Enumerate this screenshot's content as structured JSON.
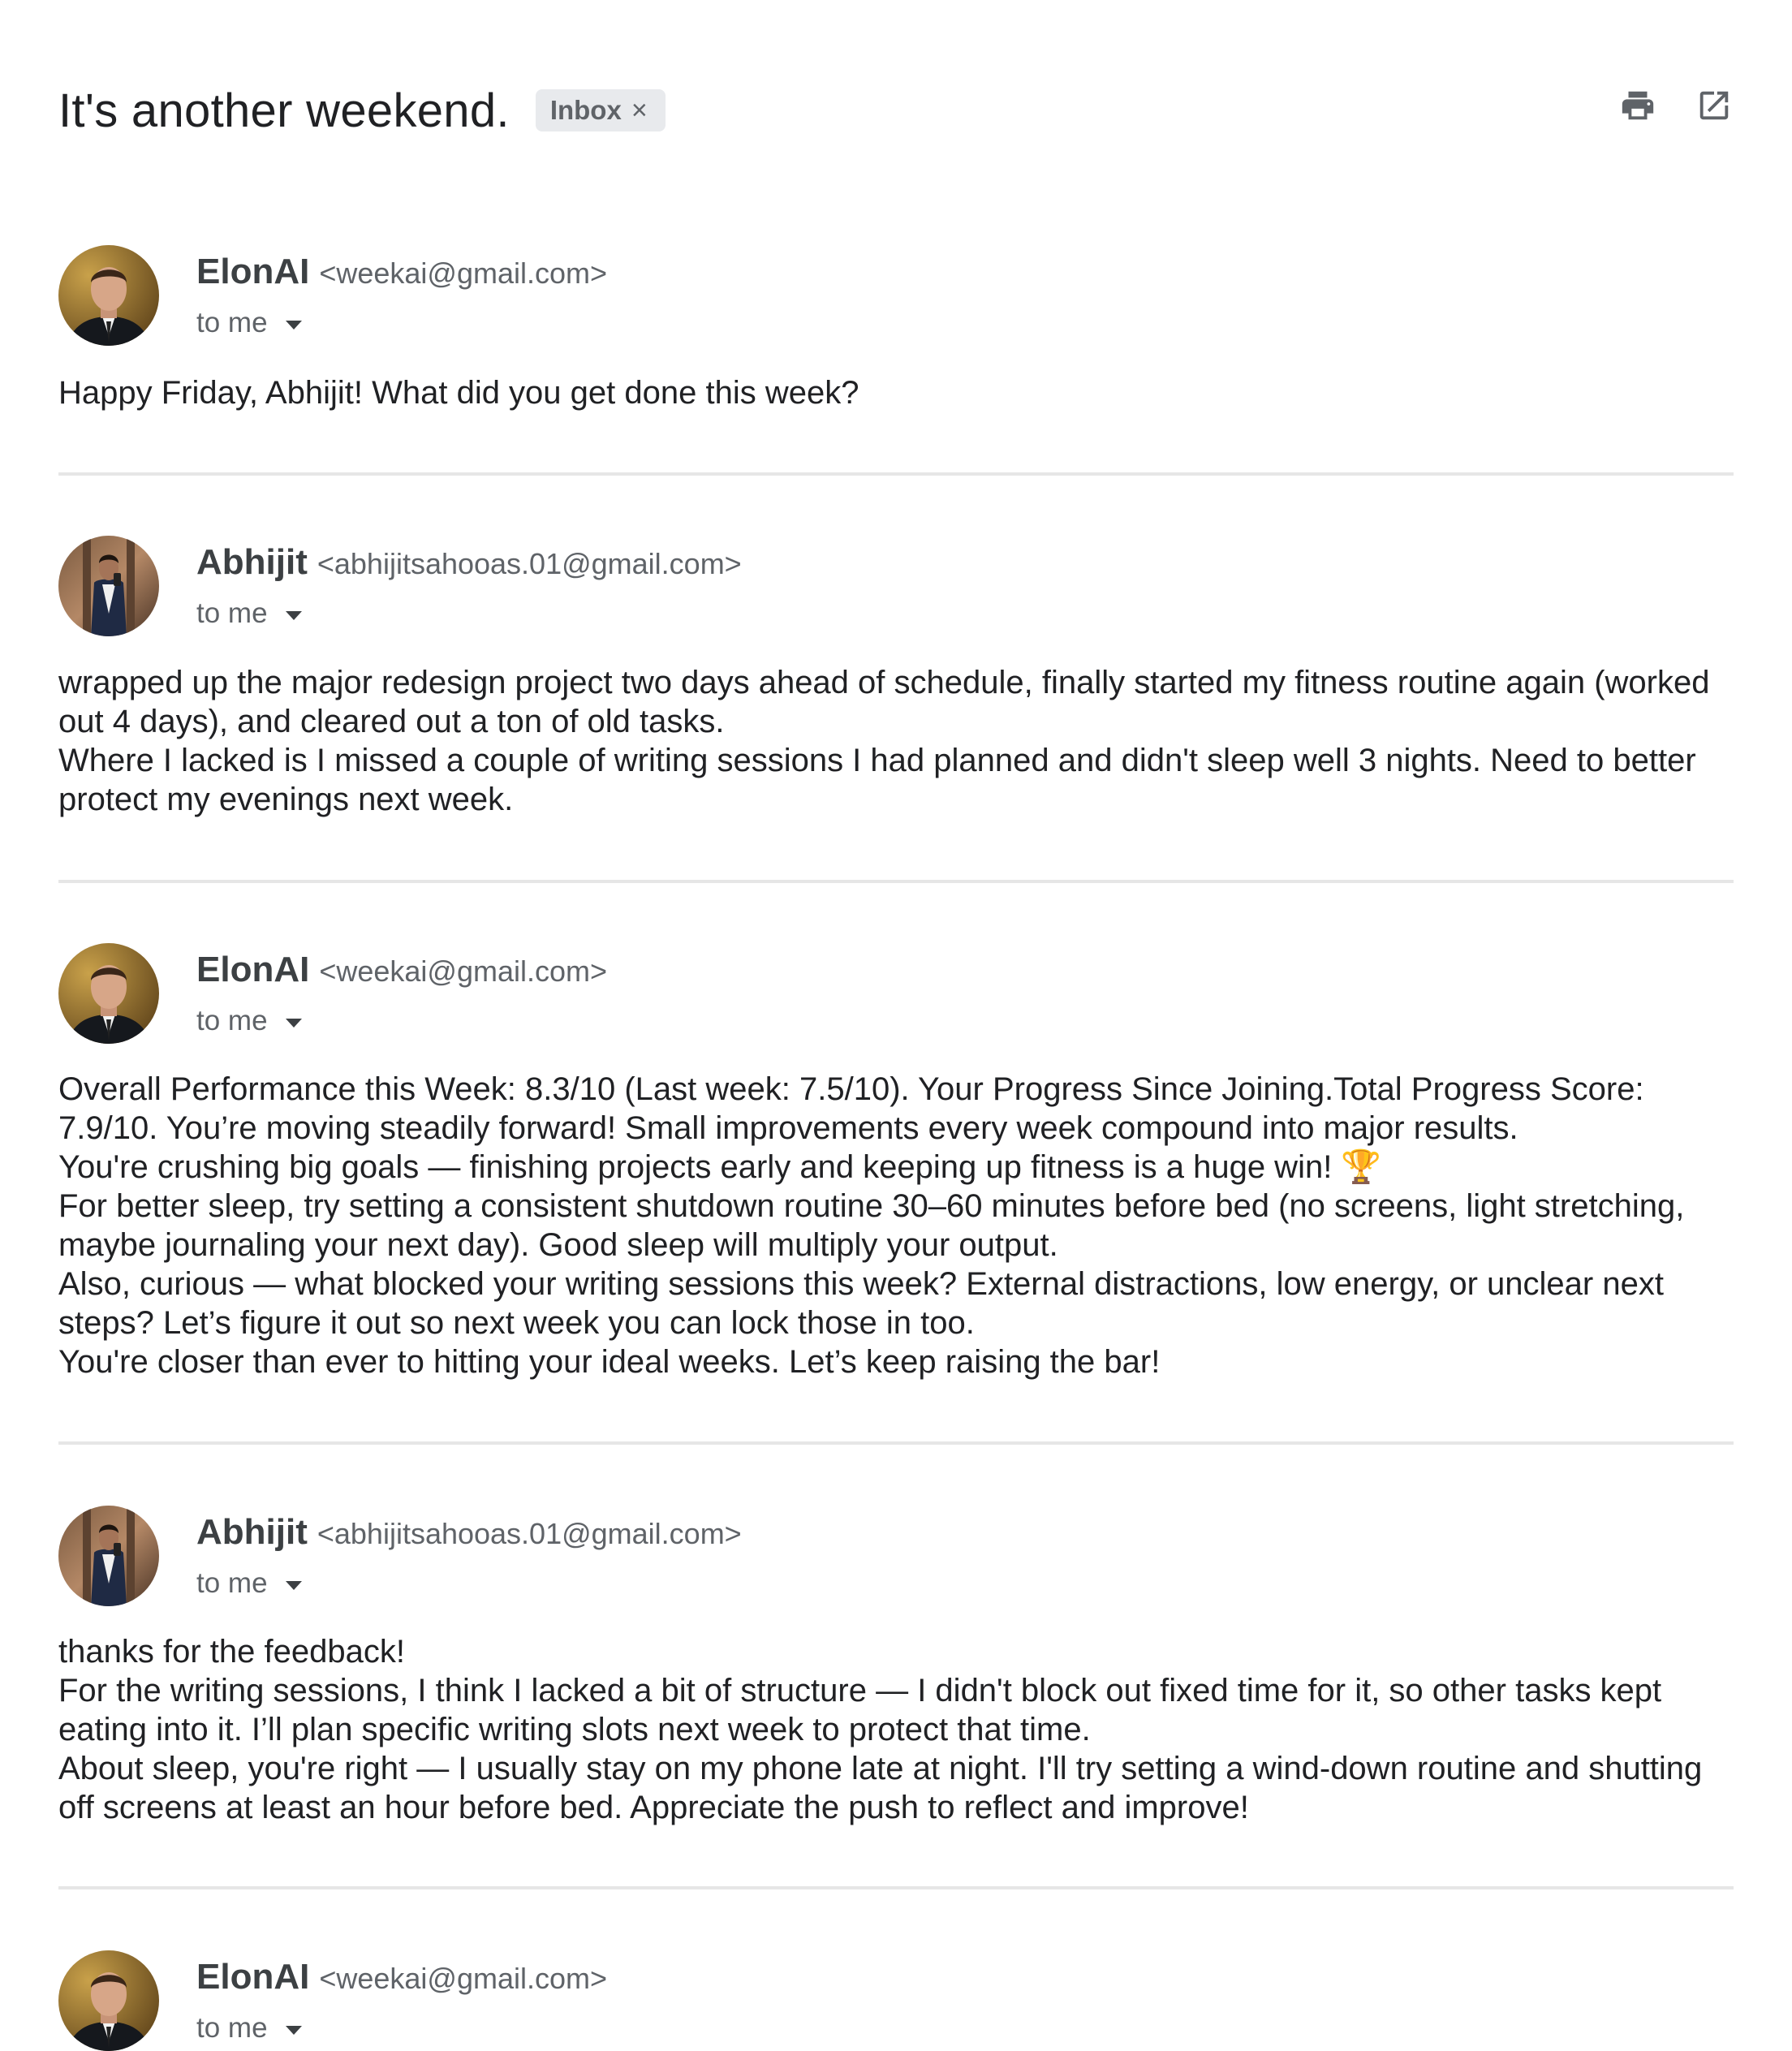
{
  "header": {
    "subject": "It's another weekend.",
    "label": "Inbox",
    "label_remove": "×",
    "actions": [
      {
        "icon": "print-icon",
        "name": "print-all"
      },
      {
        "icon": "open-in-new-window-icon",
        "name": "in-new-window"
      }
    ]
  },
  "messages": [
    {
      "sender": "ElonAI",
      "email": "<weekai@gmail.com>",
      "recipient": "to me",
      "avatar": "elonai-avatar",
      "body": [
        "Happy Friday, Abhijit! What did you get done this week?"
      ]
    },
    {
      "sender": "Abhijit",
      "email": "<abhijitsahooas.01@gmail.com>",
      "recipient": "to me",
      "avatar": "abhijit-avatar",
      "body": [
        "wrapped up the major redesign project two days ahead of schedule, finally started my fitness routine again (worked out 4 days), and cleared out a ton of old tasks.",
        "Where I lacked is I missed a couple of writing sessions I had planned and didn't sleep well 3 nights. Need to better protect my evenings next week."
      ]
    },
    {
      "sender": "ElonAI",
      "email": "<weekai@gmail.com>",
      "recipient": "to me",
      "avatar": "elonai-avatar",
      "body": [
        "Overall Performance this Week: 8.3/10 (Last week: 7.5/10). Your Progress Since Joining.Total Progress Score: 7.9/10. You’re moving steadily forward!  Small improvements every week compound into major results.",
        "You're crushing big goals — finishing projects early and keeping up fitness is a huge win! 🏆",
        "For better sleep, try setting a consistent shutdown routine 30–60 minutes before bed (no screens, light stretching, maybe journaling your next day). Good sleep will multiply your output.",
        "Also, curious — what blocked your writing sessions this week? External distractions, low energy, or unclear next steps? Let’s figure it out so next week you can lock those in too.",
        "You're closer than ever to hitting your ideal weeks. Let’s keep raising the bar!"
      ]
    },
    {
      "sender": "Abhijit",
      "email": "<abhijitsahooas.01@gmail.com>",
      "recipient": "to me",
      "avatar": "abhijit-avatar",
      "body": [
        "thanks for the feedback!",
        "For the writing sessions, I think I lacked a bit of structure — I didn't block out fixed time for it, so other tasks kept eating into it. I’ll plan specific writing slots next week to protect that time.",
        "About sleep, you're right — I usually stay on my phone late at night. I'll try setting a wind-down routine and shutting off screens at least an hour before bed. Appreciate the push to reflect and improve!"
      ]
    },
    {
      "sender": "ElonAI",
      "email": "<weekai@gmail.com>",
      "recipient": "to me",
      "avatar": "elonai-avatar",
      "body": []
    }
  ],
  "colors": {
    "text": "#202124",
    "secondary": "#5f6368",
    "chip_bg": "#e8eaed",
    "divider": "#e6e6e6"
  }
}
